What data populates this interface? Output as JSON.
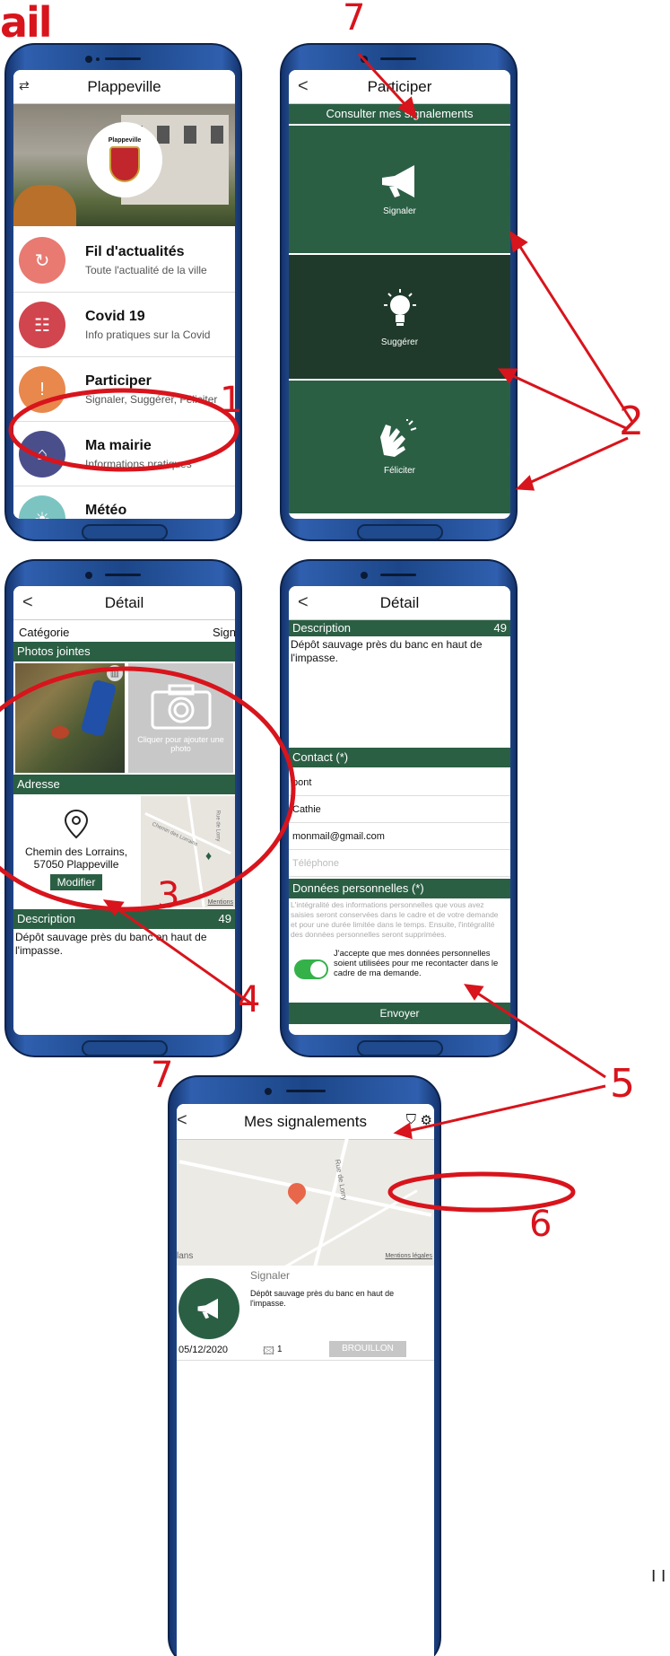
{
  "page_header_fragment": "ail",
  "page_number": "I I",
  "annotations": [
    "1",
    "2",
    "3",
    "4",
    "5",
    "6",
    "7",
    "7"
  ],
  "phone1": {
    "title": "Plappeville",
    "crest_label": "Plappeville",
    "items": [
      {
        "title": "Fil d'actualités",
        "subtitle": "Toute l'actualité de la ville",
        "color": "#e87a72",
        "icon": "refresh-icon"
      },
      {
        "title": "Covid 19",
        "subtitle": "Info pratiques sur la Covid",
        "color": "#d0454e",
        "icon": "mask-icon"
      },
      {
        "title": "Participer",
        "subtitle": "Signaler, Suggérer, Féliciter",
        "color": "#e8884c",
        "icon": "warning-icon"
      },
      {
        "title": "Ma mairie",
        "subtitle": "Informations pratiques",
        "color": "#4a4f8c",
        "icon": "townhall-icon"
      },
      {
        "title": "Météo",
        "subtitle": "",
        "color": "#7cc4c2",
        "icon": "sun-icon"
      }
    ]
  },
  "phone2": {
    "title": "Participer",
    "top_bar": "Consulter mes signalements",
    "tiles": [
      {
        "label": "Signaler",
        "icon": "megaphone-icon"
      },
      {
        "label": "Suggérer",
        "icon": "lightbulb-icon"
      },
      {
        "label": "Féliciter",
        "icon": "clapping-hands-icon"
      }
    ]
  },
  "phone3": {
    "title": "Détail",
    "category_label": "Catégorie",
    "category_value": "Signaler",
    "photos_header": "Photos jointes",
    "add_photo_text": "Cliquer pour ajouter une photo",
    "address_header": "Adresse",
    "address_line1": "Chemin des Lorrains,",
    "address_line2": "57050 Plappeville",
    "modify_button": "Modifier",
    "map_road_label": "Chemin des Lorrains",
    "map_road_label2": "Rue de Lorry",
    "map_legal": "Mentions",
    "description_header": "Description",
    "description_count": "49",
    "description_text": "Dépôt sauvage près du banc en haut de l'impasse."
  },
  "phone4": {
    "title": "Détail",
    "description_header": "Description",
    "description_count": "49",
    "description_text": "Dépôt sauvage près du banc en haut de l'impasse.",
    "contact_header": "Contact (*)",
    "contact_lastname": "pont",
    "contact_firstname": "Cathie",
    "contact_email": "monmail@gmail.com",
    "contact_phone_placeholder": "Téléphone",
    "data_header": "Données personnelles (*)",
    "data_text": "L'intégralité des informations personnelles que vous avez saisies seront conservées dans le cadre et de votre demande et pour une durée limitée dans le temps. Ensuite, l'intégralité des données personnelles seront supprimées.",
    "consent_text": "J'accepte que mes données personnelles soient utilisées pour me recontacter dans le cadre de ma demande.",
    "submit_button": "Envoyer"
  },
  "phone5": {
    "title": "Mes signalements",
    "map_place": "lans",
    "map_road": "Rue de Lorry",
    "map_legal": "Mentions légales",
    "item_type": "Signaler",
    "item_text": "Dépôt sauvage près du banc en haut de l'impasse.",
    "item_date": "05/12/2020",
    "item_photos": "1",
    "item_status": "BROUILLON"
  },
  "colors": {
    "green": "#2b5f44",
    "red": "#d8141c",
    "phone_blue": "#1c4688"
  }
}
